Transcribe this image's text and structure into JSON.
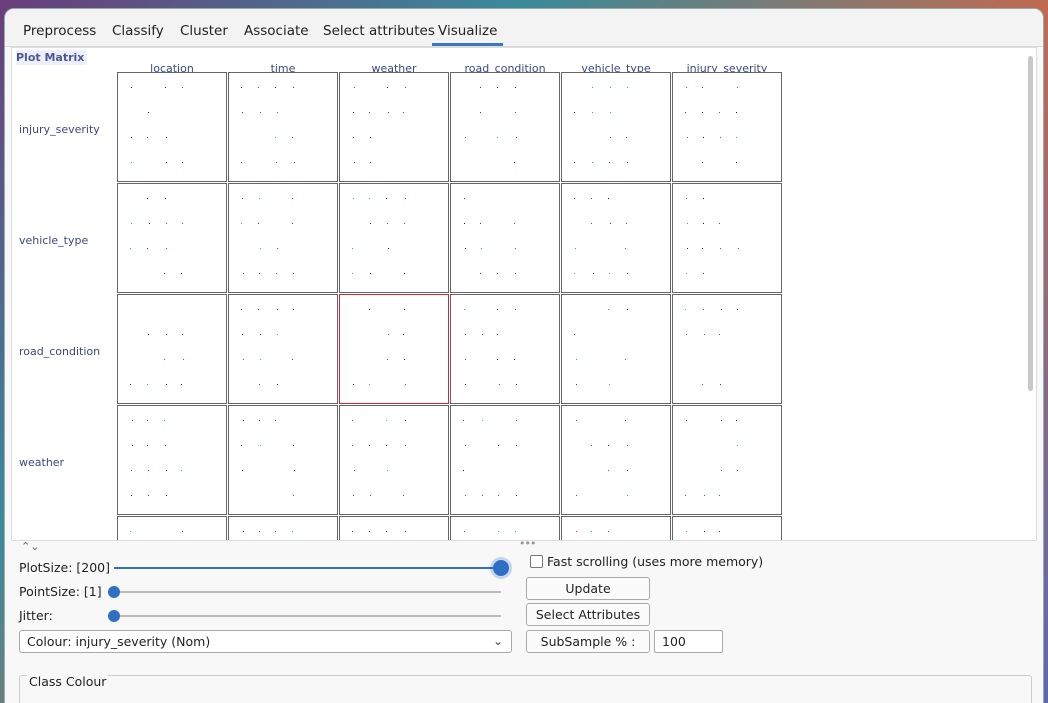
{
  "tabs": [
    "Preprocess",
    "Classify",
    "Cluster",
    "Associate",
    "Select attributes",
    "Visualize"
  ],
  "active_tab": "Visualize",
  "plot_matrix": {
    "title": "Plot Matrix",
    "columns": [
      "location",
      "time",
      "weather",
      "road_condition",
      "vehicle_type",
      "injury_severity"
    ],
    "rows": [
      "injury_severity",
      "vehicle_type",
      "road_condition",
      "weather"
    ]
  },
  "controls": {
    "plotsize_label": "PlotSize: [200]",
    "pointsize_label": "PointSize: [1]",
    "jitter_label": "Jitter:",
    "fast_scrolling_label": "Fast scrolling (uses more memory)",
    "update_label": "Update",
    "select_attributes_label": "Select Attributes",
    "colour_label": "Colour: injury_severity  (Nom)",
    "subsample_label": "SubSample % :",
    "subsample_value": "100",
    "class_colour_label": "Class Colour"
  },
  "colors": {
    "accent": "#2f6fc5",
    "dot_colors": [
      "#0000ff",
      "#ff0000",
      "#00c8c8",
      "#00a000",
      "#ff00ff"
    ]
  }
}
